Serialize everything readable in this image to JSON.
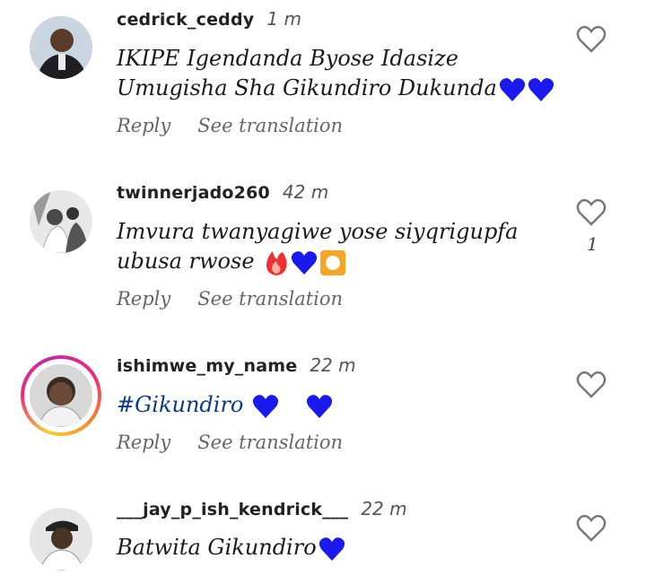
{
  "comments": [
    {
      "username": "cedrick_ceddy",
      "time": "1 m",
      "line1": "IKIPE Igendanda Byose Idasize",
      "line2": "Umugisha Sha Gikundiro Dukunda",
      "reply": "Reply",
      "translate": "See translation",
      "likes": ""
    },
    {
      "username": "twinnerjado260",
      "time": "42 m",
      "line1": "Imvura twanyagiwe yose siyqrigupfa",
      "line2": "ubusa rwose",
      "reply": "Reply",
      "translate": "See translation",
      "likes": "1"
    },
    {
      "username": "ishimwe_my_name",
      "time": "22 m",
      "line1": "#Gikundiro",
      "reply": "Reply",
      "translate": "See translation",
      "likes": ""
    },
    {
      "username": "___jay_p_ish_kendrick___",
      "time": "22 m",
      "line1": "Batwita Gikundiro",
      "likes": ""
    }
  ],
  "icons": {
    "like": "heart-outline-icon",
    "emoji_heart_color": "#1a1aee",
    "emoji_fire_color": "#f03030",
    "emoji_record_color": "#f5a623"
  }
}
